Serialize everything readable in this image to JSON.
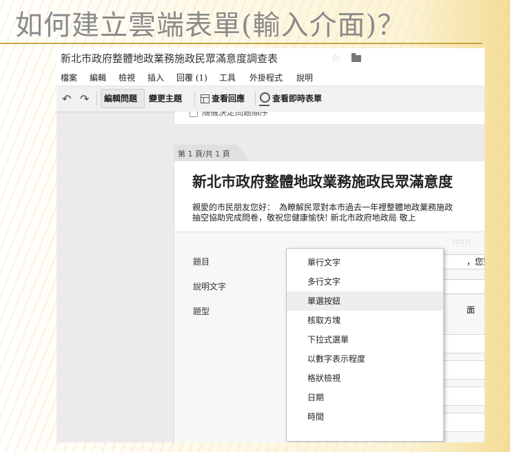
{
  "slide": {
    "title": "如何建立雲端表單(輸入介面)？"
  },
  "app": {
    "doc_title": "新北市政府整體地政業務施政民眾滿意度調查表",
    "menu": [
      "檔案",
      "編輯",
      "檢視",
      "插入",
      "回覆 (1)",
      "工具",
      "外掛程式",
      "說明"
    ],
    "toolbar": {
      "edit_questions": "編輯問題",
      "change_theme": "變更主題",
      "view_responses": "查看回應",
      "view_live_form": "查看即時表單"
    },
    "partial_option": "隨機決定問題順序"
  },
  "form": {
    "page_indicator": "第 1 頁/共 1 頁",
    "title": "新北市政府整體地政業務施政民眾滿意度",
    "description_line1": "親愛的市民朋友您好：　為瞭解民眾對本市過去一年裡整體地政業務施政",
    "description_line2": "抽空協助完成問卷，敬祝您健康愉快! 新北市政府地政局 敬上"
  },
  "question_editor": {
    "label_title": "題目",
    "label_help": "說明文字",
    "label_type": "題型",
    "title_value_fragment": "，您對於",
    "type_value_fragment": "面",
    "drag_handle": "::::::"
  },
  "type_dropdown": {
    "selected": "單選按鈕",
    "options": [
      "單行文字",
      "多行文字",
      "單選按鈕",
      "核取方塊",
      "下拉式選單",
      "以數字表示程度",
      "格狀檢視",
      "日期",
      "時間"
    ]
  }
}
